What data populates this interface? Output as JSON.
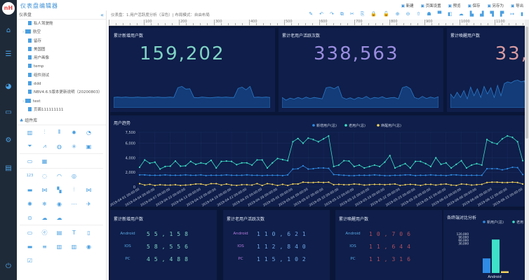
{
  "app": {
    "title": "仪表盘编辑器",
    "logo_text": "nH"
  },
  "rail": [
    {
      "icon": "home-icon",
      "g": "⌂"
    },
    {
      "icon": "database-icon",
      "g": "☰"
    },
    {
      "icon": "dashboard-gauge-icon",
      "g": "◕"
    },
    {
      "icon": "monitor-icon",
      "g": "▭"
    },
    {
      "icon": "settings-cogs-icon",
      "g": "⚙"
    },
    {
      "icon": "pdf-file-icon",
      "g": "▤"
    },
    {
      "icon": "power-icon",
      "g": "⏻"
    }
  ],
  "top_buttons": [
    {
      "icon": "new-icon",
      "label": "新建"
    },
    {
      "icon": "page-settings-icon",
      "label": "页面设置"
    },
    {
      "icon": "preview-eye-icon",
      "label": "预览"
    },
    {
      "icon": "save-icon",
      "label": "保存"
    },
    {
      "icon": "save-as-icon",
      "label": "另存为"
    },
    {
      "icon": "export-icon",
      "label": "导出"
    }
  ],
  "sidebar": {
    "header": "仪表盘",
    "collapse_glyph": "«",
    "tree": [
      {
        "label": "私人驾驶舱",
        "type": "file"
      },
      {
        "label": "航空",
        "type": "folder"
      },
      {
        "label": "留存",
        "type": "file"
      },
      {
        "label": "美国图",
        "type": "file"
      },
      {
        "label": "用户画像",
        "type": "file"
      },
      {
        "label": "temp",
        "type": "file"
      },
      {
        "label": "组件测试",
        "type": "file"
      },
      {
        "label": "ddd",
        "type": "file"
      },
      {
        "label": "NBV4.6.5版本更新说明（20200803）",
        "type": "file"
      },
      {
        "label": "test",
        "type": "folder"
      },
      {
        "label": "页面111111111",
        "type": "file"
      }
    ],
    "library_header": "组件库",
    "component_rows": [
      [
        "▥",
        "⫶",
        "⦀",
        "✹",
        "◔"
      ],
      [
        "⏷",
        "⩘",
        "◍",
        "✳",
        "▣"
      ],
      [
        "sep"
      ],
      [
        "▭",
        "▦"
      ],
      [
        "sep"
      ],
      [
        "123",
        "◌",
        "◠",
        "◎"
      ],
      [
        "▬",
        "⋈",
        "▚",
        "⦙",
        "⋈"
      ],
      [
        "✺",
        "❄",
        "◉",
        "⋯",
        "✈"
      ],
      [
        "⊙",
        "☁",
        "☁"
      ],
      [
        "sep"
      ],
      [
        "▭",
        "ⓔ",
        "▤",
        "T",
        "▯"
      ],
      [
        "▬",
        "≡",
        "▥",
        "▥",
        "◉"
      ],
      [
        "☑"
      ]
    ]
  },
  "toolbar": {
    "info": "仪表盘：1.用户活跃度分析（深色）| 布局模式：自由布局",
    "tools": [
      "✎",
      "↶",
      "↷",
      "⧉",
      "✂",
      "⎘",
      "🔒",
      "🔓",
      "⊕",
      "⊖",
      "⇧",
      "☗",
      "▀",
      "◧",
      "☁",
      "▙",
      "▟",
      "▜",
      "▛",
      "↦",
      "▮"
    ]
  },
  "ruler": {
    "labels": [
      "100",
      "200",
      "300",
      "400",
      "500",
      "600",
      "700",
      "800",
      "900",
      "1000",
      "1100"
    ]
  },
  "kpi_cards": [
    {
      "title": "累计新增用户数",
      "value": "159,202",
      "color": "#7fd3c4",
      "spark": [
        30,
        31,
        30,
        31,
        30,
        30,
        31,
        30,
        30,
        31,
        30,
        31,
        30,
        30,
        31,
        30,
        58,
        62,
        54,
        55,
        30,
        29,
        31,
        30,
        29,
        30,
        31,
        30,
        31,
        30,
        30,
        56,
        60,
        52,
        62,
        30,
        31,
        30,
        31,
        30
      ]
    },
    {
      "title": "累计老用户活跃次数",
      "value": "338,563",
      "color": "#9b8de0",
      "spark": [
        30,
        22,
        28,
        25,
        30,
        26,
        31,
        27,
        30,
        28,
        26,
        58,
        60,
        55,
        62,
        30,
        25,
        29,
        24,
        30,
        27,
        33,
        26,
        30,
        28,
        32,
        27,
        29,
        30,
        26,
        58,
        62,
        55,
        30,
        26,
        33,
        27,
        31,
        28,
        32
      ]
    },
    {
      "title": "累计唤醒用户数",
      "value": "33,",
      "color": "#d89aa0",
      "spark": [
        40,
        28,
        45,
        30,
        50,
        26,
        60,
        35,
        55,
        30,
        62,
        40,
        58,
        30,
        65,
        35,
        70,
        75,
        72,
        78,
        80,
        75,
        78,
        30,
        55,
        40
      ]
    }
  ],
  "trend": {
    "title": "用户趋势",
    "legend": [
      {
        "name": "新增用户(总)",
        "color": "#2f8be6"
      },
      {
        "name": "老用户(总)",
        "color": "#3ee0c8"
      },
      {
        "name": "唤醒用户(总)",
        "color": "#f3d35b"
      }
    ]
  },
  "chart_data": [
    {
      "type": "line",
      "title": "用户趋势",
      "ylim": [
        0,
        7500
      ],
      "yticks": [
        "0",
        "2,000",
        "4,000",
        "6,000",
        "7,500"
      ],
      "grid": true,
      "legend_position": "top-right",
      "x": [
        "2019-04-01 00:00:00",
        "2019-04-02 00:00:00",
        "2019-04-03 00:00:00",
        "2019-04-04 00:00:00",
        "2019-04-05 00:00:00",
        "2019-04-06 00:00:00",
        "2019-04-07 00:00:00",
        "2019-04-08 00:00:00",
        "2019-04-09 00:00:00",
        "2019-04-10 00:00:00",
        "2019-04-11 00:00:00",
        "2019-04-12 00:00:00",
        "2019-04-13 00:00:00",
        "2019-04-14 00:00:00",
        "2019-04-15 00:00:00",
        "2019-04-16 00:00:00",
        "2019-04-17 00:00:00",
        "2019-04-18 00:00:00",
        "2019-04-19 00:00:00",
        "2019-04-20 00:00:00",
        "2019-04-21 00:00:00",
        "2019-04-22 00:00:00",
        "2019-04-23 00:00:00",
        "2019-04-24 00:00:00",
        "2019-04-25 00:00:00",
        "2019-04-26 00:00:00",
        "2019-04-27 00:00:00",
        "2019-04-28 00:00:00",
        "2019-04-29 00:00:00",
        "2019-04-30 00:00:00",
        "2019-05-01 00:00:00",
        "2019-05-02 00:00:00",
        "2019-05-03 00:00:00",
        "2019-05-04 00:00:00",
        "2019-05-05 00:00:00",
        "2019-05-06 00:00:00",
        "2019-05-07 00:00:00",
        "2019-05-08 00:00:00",
        "2019-05-09 00:00:00",
        "2019-05-10 00:00:00",
        "2019-05-11 00:00:00",
        "2019-05-12 00:00:00",
        "2019-05-13 00:00:00",
        "2019-05-14 00:00:00",
        "2019-05-15 00:00:00",
        "2019-05-16 00:00:00",
        "2019-05-17 00:00:00",
        "2019-05-18 00:00:00",
        "2019-05-19 00:00:00",
        "2019-05-20 00:00:00",
        "2019-05-21 00:00:00",
        "2019-05-22 00:00:00",
        "2019-05-23 00:00:00",
        "2019-05-24 00:00:00",
        "2019-05-25 00:00:00",
        "2019-05-26 00:00:00",
        "2019-05-27 00:00:00",
        "2019-05-28 00:00:00",
        "2019-05-29 00:00:00",
        "2019-05-30 00:00:00",
        "2019-05-31 00:00:00",
        "2019-06-01 00:00:00",
        "2019-06-02 00:00:00",
        "2019-06-03 00:00:00",
        "2019-06-04 00:00:00",
        "2019-06-05 00:00:00",
        "2019-06-06 00:00:00",
        "2019-06-07 00:00:00",
        "2019-06-08 00:00:00",
        "2019-06-09 00:00:00",
        "2019-06-10 00:00:00",
        "2019-06-11 00:00:00",
        "2019-06-12 00:00:00",
        "2019-06-13 00:00:00",
        "2019-06-14 00:00:00",
        "2019-06-15 00:00:00"
      ],
      "series": [
        {
          "name": "新增用户(总)",
          "values": [
            1650,
            1650,
            1600,
            1600,
            1600,
            1650,
            1600,
            1600,
            1600,
            1650,
            1600,
            1600,
            1650,
            1550,
            1600,
            1600,
            1600,
            1650,
            1600,
            1600,
            1600,
            1650,
            1600,
            1600,
            1550,
            1600,
            1600,
            1600,
            1550,
            1650,
            2450,
            2500,
            2900,
            2450,
            2500,
            2600,
            2600,
            2550,
            1700,
            1650,
            1600,
            1550,
            1550,
            1600,
            1600,
            1600,
            1650,
            1600,
            1550,
            1550,
            1600,
            1600,
            1650,
            1650,
            1550,
            1600,
            1600,
            1650,
            1600,
            1600,
            1550,
            1650,
            1650,
            1600,
            1600,
            1600,
            1600,
            1600,
            2500,
            2500,
            2500,
            2350,
            2500,
            2700,
            2650,
            1700
          ]
        },
        {
          "name": "老用户(总)",
          "values": [
            2700,
            3700,
            3250,
            3400,
            2450,
            2800,
            2850,
            3550,
            2850,
            2900,
            3500,
            3100,
            3300,
            3150,
            3650,
            2600,
            3500,
            3550,
            3500,
            3050,
            3300,
            3300,
            3000,
            3700,
            3700,
            2600,
            3300,
            3900,
            3750,
            3600,
            6200,
            6650,
            6000,
            6700,
            6500,
            6200,
            6600,
            7000,
            2800,
            3000,
            3600,
            3550,
            2800,
            3000,
            2600,
            2800,
            3000,
            2800,
            3400,
            4300,
            2600,
            2900,
            3200,
            2600,
            3500,
            3500,
            3200,
            2800,
            4000,
            3100,
            3300,
            2600,
            3100,
            3600,
            2600,
            3000,
            3200,
            3000,
            6500,
            6100,
            5900,
            6600,
            7000,
            6800,
            6200,
            3600
          ]
        },
        {
          "name": "唤醒用户(总)",
          "values": [
            450,
            250,
            350,
            200,
            300,
            250,
            250,
            300,
            200,
            250,
            300,
            400,
            400,
            250,
            450,
            450,
            250,
            400,
            250,
            200,
            300,
            300,
            250,
            450,
            200,
            450,
            350,
            200,
            350,
            200,
            400,
            400,
            650,
            600,
            600,
            650,
            600,
            650,
            300,
            350,
            300,
            300,
            400,
            350,
            250,
            300,
            350,
            350,
            300,
            350,
            400,
            200,
            300,
            350,
            300,
            200,
            350,
            350,
            250,
            350,
            400,
            250,
            200,
            400,
            350,
            250,
            300,
            350,
            600,
            650,
            650,
            600,
            600,
            650,
            600,
            400
          ]
        }
      ]
    },
    {
      "type": "bar",
      "title": "各终端对比分析",
      "categories": [
        "Android"
      ],
      "yticks": [
        "30,000",
        "60,000",
        "90,000",
        "120,000"
      ],
      "legend_position": "top-right",
      "series": [
        {
          "name": "新用户(总)",
          "color": "#2f8be6",
          "values": [
            55158
          ]
        },
        {
          "name": "老用户(总)",
          "color": "#3ee0c8",
          "values": [
            110621
          ]
        },
        {
          "name": "唤醒用户(总)",
          "color": "#f3d35b",
          "values": [
            10706
          ]
        }
      ]
    }
  ],
  "breakdown_cards": [
    {
      "title": "累计新增用户数",
      "label_color": "#5aa9e6",
      "value_color": "#7fd3c4",
      "rows": [
        {
          "label": "Android",
          "value": "55,158"
        },
        {
          "label": "IOS",
          "value": "58,556"
        },
        {
          "label": "PC",
          "value": "45,488"
        }
      ]
    },
    {
      "title": "累计老用户活跃次数",
      "label_color": "#b77be0",
      "value_color": "#6fa8e8",
      "rows": [
        {
          "label": "Android",
          "value": "110,621"
        },
        {
          "label": "IOS",
          "value": "112,840"
        },
        {
          "label": "PC",
          "value": "115,102"
        }
      ]
    },
    {
      "title": "累计唤醒用户数",
      "label_color": "#5aa9e6",
      "value_color": "#b05060",
      "rows": [
        {
          "label": "Android",
          "value": "10,706"
        },
        {
          "label": "IOS",
          "value": "11,644"
        },
        {
          "label": "PC",
          "value": "11,316"
        }
      ]
    }
  ],
  "bar_legend": [
    "新用户(总)",
    "老用"
  ]
}
